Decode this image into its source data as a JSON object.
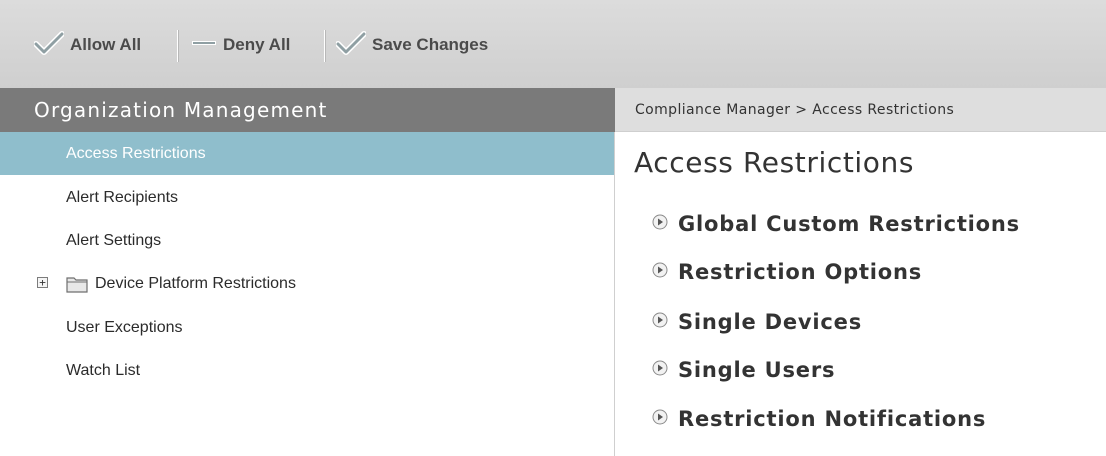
{
  "toolbar": {
    "allow_all": "Allow All",
    "deny_all": "Deny All",
    "save_changes": "Save Changes"
  },
  "sidebar": {
    "header": "Organization Management",
    "items": [
      {
        "label": "Access Restrictions",
        "selected": true
      },
      {
        "label": "Alert Recipients"
      },
      {
        "label": "Alert Settings"
      },
      {
        "label": "Device Platform Restrictions",
        "expandable": true,
        "icon": "folder-icon"
      },
      {
        "label": "User Exceptions"
      },
      {
        "label": "Watch List"
      }
    ]
  },
  "content": {
    "breadcrumb": "Compliance Manager > Access Restrictions",
    "title": "Access Restrictions",
    "sections": [
      {
        "label": "Global Custom Restrictions"
      },
      {
        "label": "Restriction Options"
      },
      {
        "label": "Single Devices"
      },
      {
        "label": "Single Users"
      },
      {
        "label": "Restriction Notifications"
      }
    ]
  },
  "colors": {
    "toolbar_bg": "#d4d4d4",
    "sidebar_header_bg": "#7a7a7a",
    "selected_item_bg": "#8fbecc",
    "checkmark": "#8a9a9a"
  }
}
